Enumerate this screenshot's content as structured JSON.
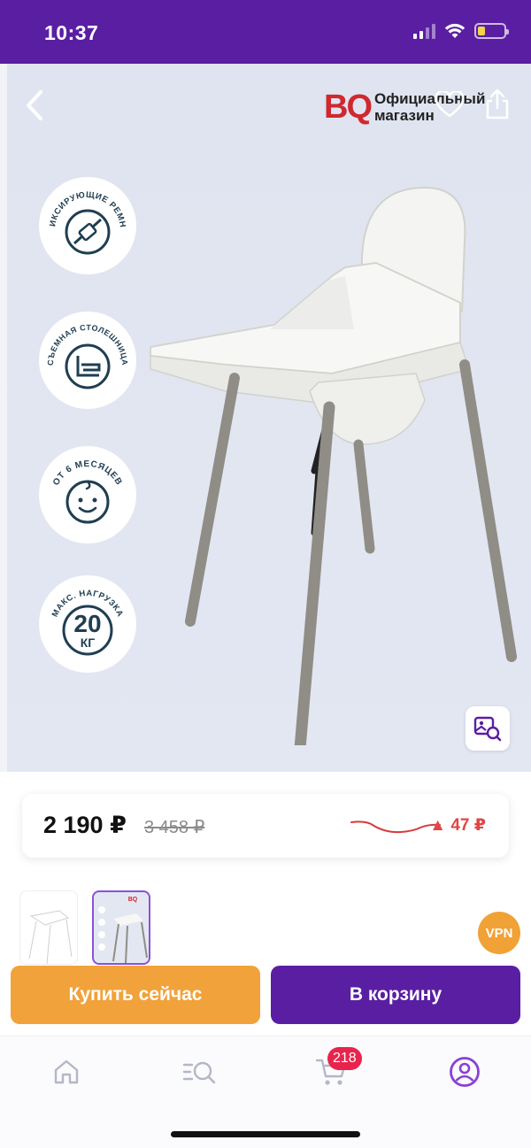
{
  "status": {
    "time": "10:37"
  },
  "header": {
    "brand_logo": "BQ",
    "brand_line1": "Официальный",
    "brand_line2": "магазин"
  },
  "badges": [
    {
      "text": "ФИКСИРУЮЩИЕ РЕМНИ",
      "icon": "seat-belt-icon"
    },
    {
      "text": "СЪЕМНАЯ СТОЛЕШНИЦА",
      "icon": "removable-tray-icon"
    },
    {
      "text": "ОТ 6 МЕСЯЦЕВ",
      "number": "6",
      "icon": "baby-face-icon"
    },
    {
      "text": "МАКС. НАГРУЗКА",
      "number": "20",
      "unit": "КГ",
      "icon": "max-load-icon"
    }
  ],
  "price": {
    "current": "2 190 ₽",
    "old": "3 458 ₽",
    "delta": "▲ 47 ₽"
  },
  "vpn_label": "VPN",
  "actions": {
    "buy_now": "Купить сейчас",
    "add_to_cart": "В корзину"
  },
  "tabbar": {
    "cart_count": "218"
  },
  "colors": {
    "brand_purple": "#5a1ea3",
    "buy_orange": "#f2a23a",
    "price_up_red": "#e04646",
    "cart_badge": "#e8244c",
    "logo_red": "#d0282e"
  }
}
